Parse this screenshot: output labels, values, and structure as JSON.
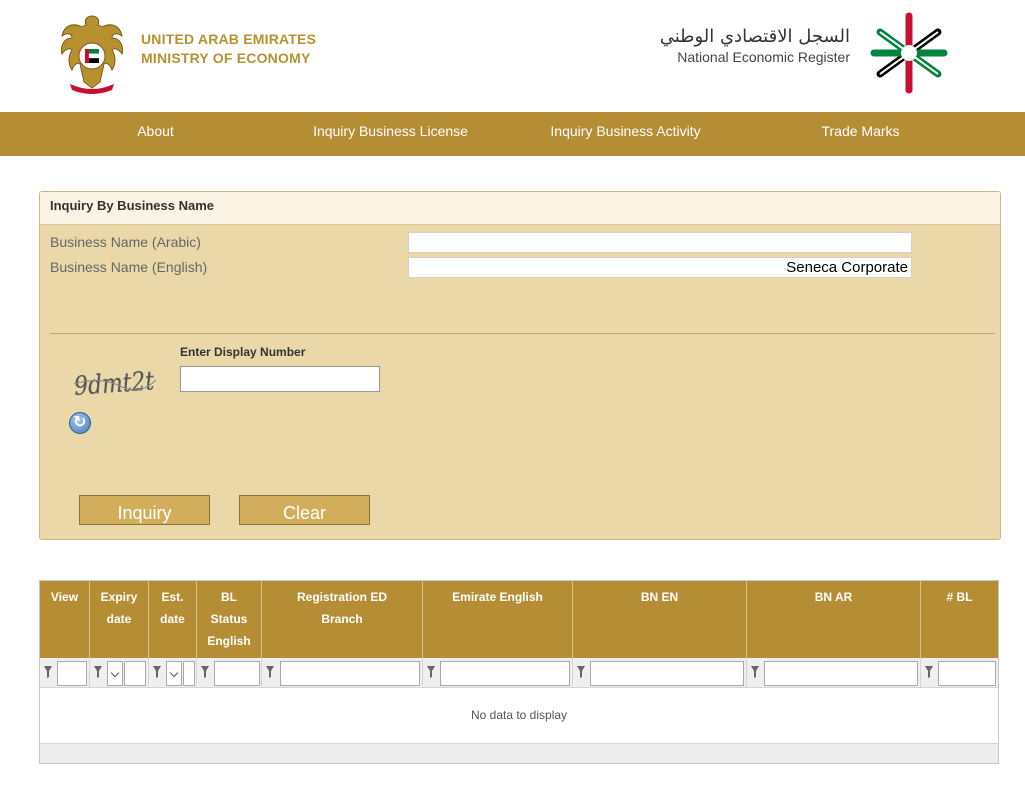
{
  "header": {
    "ministry_line1": "UNITED ARAB EMIRATES",
    "ministry_line2": "MINISTRY OF ECONOMY",
    "register_ar": "السجل الاقتصادي الوطني",
    "register_en": "National Economic Register"
  },
  "nav": {
    "items": [
      "About",
      "Inquiry Business License",
      "Inquiry Business Activity",
      "Trade Marks"
    ]
  },
  "form": {
    "title": "Inquiry By Business Name",
    "arabic_label": "Business Name (Arabic)",
    "arabic_value": "",
    "english_label": "Business Name (English)",
    "english_value": "Seneca Corporate",
    "captcha_label": "Enter Display Number",
    "captcha_text": "9dmt2t",
    "captcha_value": "",
    "inquiry_label": "Inquiry",
    "clear_label": "Clear"
  },
  "grid": {
    "columns": [
      [
        "View"
      ],
      [
        "Expiry",
        "date"
      ],
      [
        "Est.",
        "date"
      ],
      [
        "BL",
        "Status",
        "English"
      ],
      [
        "Registration ED",
        "Branch"
      ],
      [
        "Emirate English"
      ],
      [
        "BN EN"
      ],
      [
        "BN AR"
      ],
      [
        "# BL"
      ]
    ],
    "empty_text": "No data to display"
  },
  "colors": {
    "gold": "#b58d34",
    "panel": "#ead8a8",
    "button": "#d2ad5b"
  }
}
